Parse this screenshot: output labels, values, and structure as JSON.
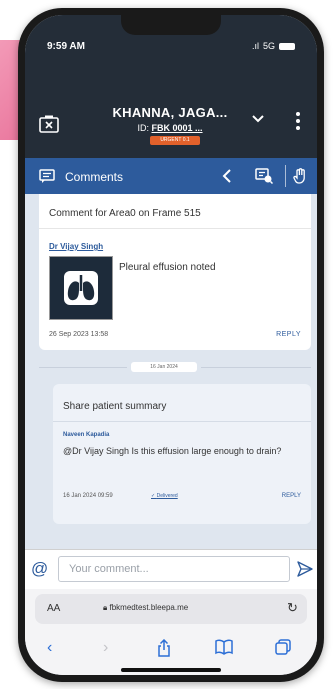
{
  "status": {
    "time": "9:59 AM",
    "signal": "5G"
  },
  "header": {
    "patient_name": "KHANNA, JAGA...",
    "id_prefix": "ID:",
    "id_value": "FBK 0001 ...",
    "badge": "URGENT 0.1"
  },
  "comments_bar": {
    "title": "Comments"
  },
  "comments": [
    {
      "title": "Comment for Area0 on Frame 515",
      "author": "Dr Vijay Singh",
      "text": "Pleural effusion noted",
      "date": "26 Sep 2023 13:58",
      "reply": "REPLY"
    }
  ],
  "date_separator": "16 Jan 2024",
  "reply_card": {
    "title": "Share patient summary",
    "author": "Naveen Kapadia",
    "text": "@Dr Vijay Singh Is this effusion large enough to drain?",
    "date": "16 Jan 2024 09:59",
    "status": "Delivered",
    "reply": "REPLY"
  },
  "input": {
    "placeholder": "Your comment...",
    "at_symbol": "@"
  },
  "browser": {
    "aa": "AA",
    "url": "fbkmedtest.bleepa.me"
  },
  "colors": {
    "header": "#242d38",
    "bar": "#2d5b9c",
    "accent": "#e2612b",
    "background": "#dfe6ef"
  },
  "icons": [
    "close-patient-icon",
    "chevron-down-icon",
    "more-vertical-icon",
    "comment-icon",
    "chevron-left-icon",
    "toolbox-icon",
    "hand-icon",
    "lungs-icon",
    "send-icon",
    "lock-icon",
    "reload-icon",
    "back-icon",
    "forward-icon",
    "share-icon",
    "bookmarks-icon",
    "tabs-icon"
  ]
}
